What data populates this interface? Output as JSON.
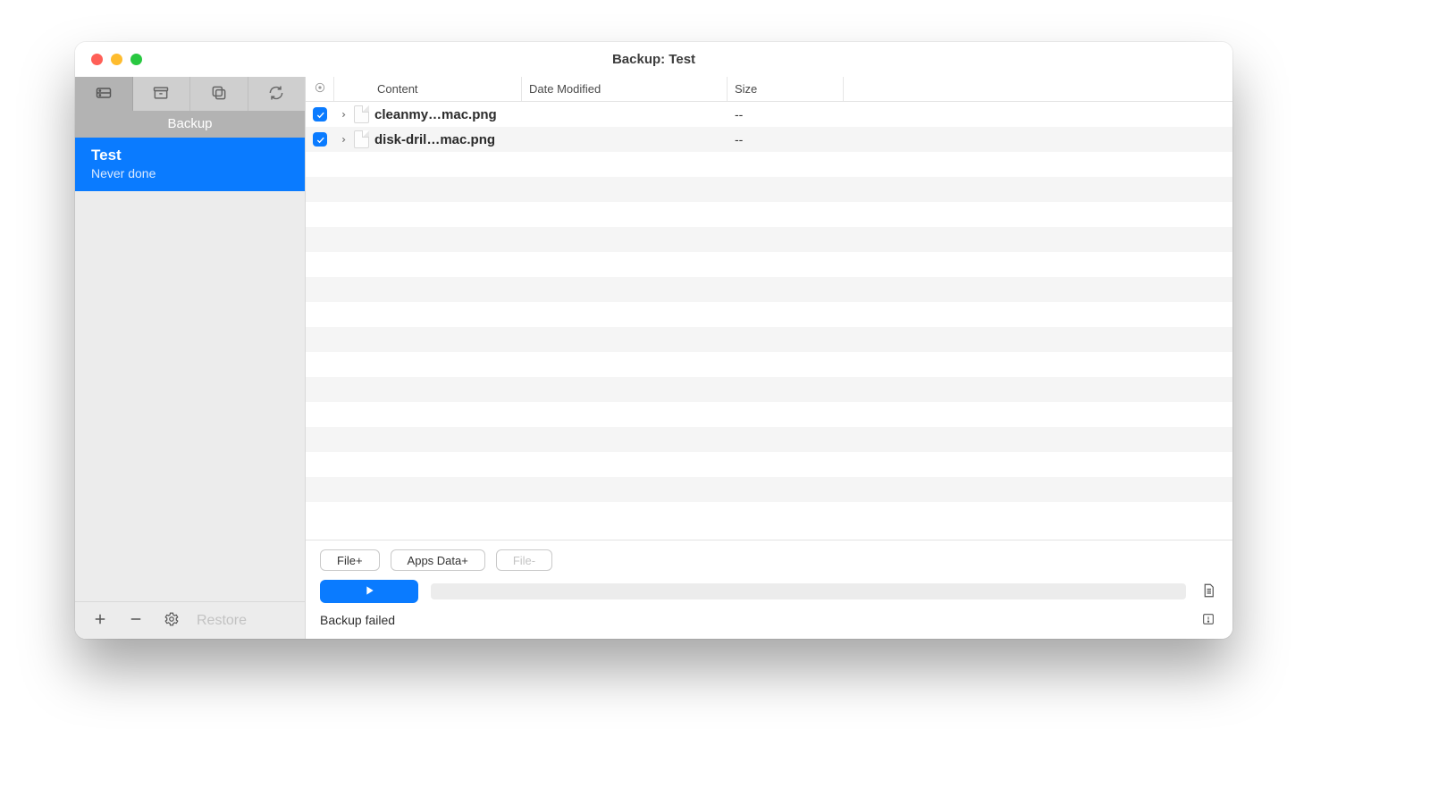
{
  "window": {
    "title": "Backup: Test"
  },
  "sidebar": {
    "section_title": "Backup",
    "item": {
      "name": "Test",
      "status": "Never done"
    },
    "restore_label": "Restore"
  },
  "columns": {
    "content": "Content",
    "date": "Date Modified",
    "size": "Size"
  },
  "rows": [
    {
      "checked": true,
      "name": "cleanmy…mac.png",
      "date": "",
      "size": "--"
    },
    {
      "checked": true,
      "name": "disk-dril…mac.png",
      "date": "",
      "size": "--"
    }
  ],
  "buttons": {
    "file_add": "File+",
    "apps_data_add": "Apps Data+",
    "file_remove": "File-"
  },
  "status": {
    "message": "Backup failed"
  }
}
